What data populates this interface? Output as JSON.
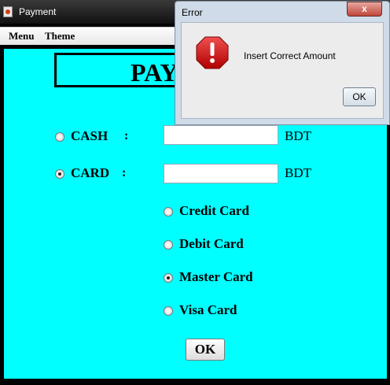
{
  "window": {
    "title": "Payment",
    "menu": [
      "Menu",
      "Theme"
    ]
  },
  "form": {
    "heading": "PAY",
    "cash": {
      "label": "CASH",
      "colon": ":",
      "value": "",
      "unit": "BDT",
      "selected": false
    },
    "card": {
      "label": "CARD",
      "colon": ":",
      "value": "",
      "unit": "BDT",
      "selected": true
    },
    "card_types": [
      {
        "label": "Credit Card",
        "selected": false
      },
      {
        "label": "Debit Card",
        "selected": false
      },
      {
        "label": "Master Card",
        "selected": true
      },
      {
        "label": "Visa Card",
        "selected": false
      }
    ],
    "ok_label": "OK"
  },
  "dialog": {
    "title": "Error",
    "close_label": "x",
    "message": "Insert Correct Amount",
    "ok_label": "OK",
    "icon": "stop-error-icon"
  },
  "colors": {
    "content_bg": "#00ffff",
    "titlebar": "#111111",
    "dialog_bg": "#cfdbe8",
    "close_button": "#c0463a",
    "error_icon": "#d01010"
  }
}
